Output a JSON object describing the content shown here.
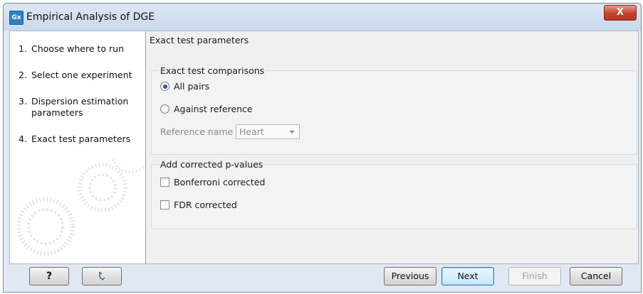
{
  "window": {
    "app_icon_text": "Gx",
    "title": "Empirical Analysis of DGE",
    "close_label": "X"
  },
  "steps": [
    {
      "number": "1.",
      "label": "Choose where to run"
    },
    {
      "number": "2.",
      "label": "Select one experiment"
    },
    {
      "number": "3.",
      "label": "Dispersion estimation parameters"
    },
    {
      "number": "4.",
      "label": "Exact test parameters"
    }
  ],
  "main": {
    "title": "Exact test parameters",
    "comparisons": {
      "legend": "Exact test comparisons",
      "option_all_pairs": "All pairs",
      "option_against_reference": "Against reference",
      "selected": "All pairs",
      "reference_label": "Reference name",
      "reference_value": "Heart"
    },
    "corrected": {
      "legend": "Add corrected p-values",
      "bonferroni": "Bonferroni corrected",
      "bonferroni_checked": false,
      "fdr": "FDR corrected",
      "fdr_checked": false
    }
  },
  "footer": {
    "help_label": "?",
    "restore_icon": "restore-defaults-icon",
    "previous": "Previous",
    "next": "Next",
    "finish": "Finish",
    "cancel": "Cancel"
  }
}
